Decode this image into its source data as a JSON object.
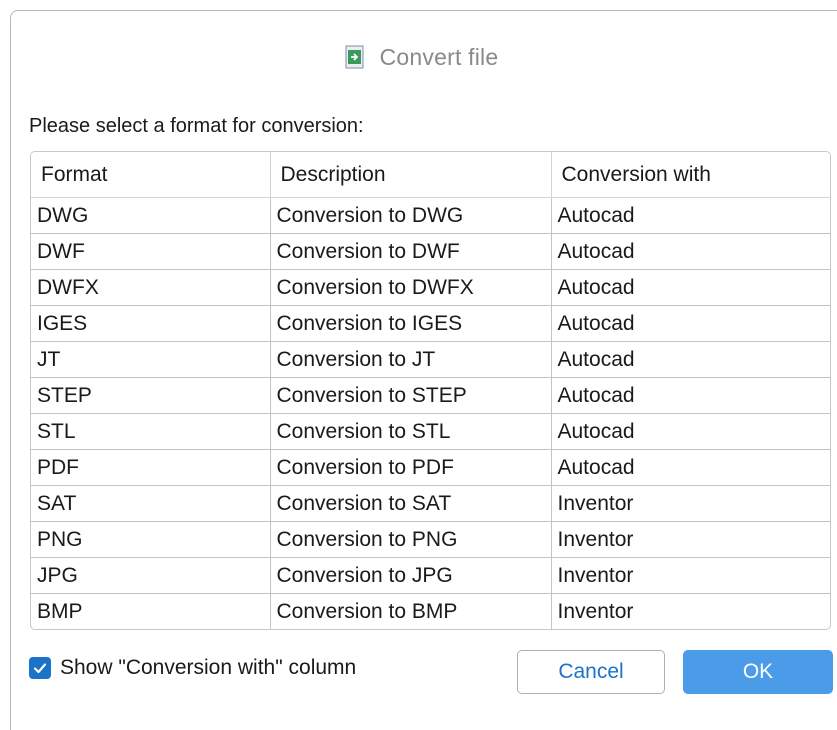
{
  "dialog": {
    "title": "Convert file",
    "title_icon": "convert-file-icon",
    "prompt": "Please select a format for conversion:"
  },
  "table": {
    "columns": [
      "Format",
      "Description",
      "Conversion with"
    ],
    "rows": [
      [
        "DWG",
        "Conversion to DWG",
        "Autocad"
      ],
      [
        "DWF",
        "Conversion to DWF",
        "Autocad"
      ],
      [
        "DWFX",
        "Conversion to DWFX",
        "Autocad"
      ],
      [
        "IGES",
        "Conversion to IGES",
        "Autocad"
      ],
      [
        "JT",
        "Conversion to JT",
        "Autocad"
      ],
      [
        "STEP",
        "Conversion to STEP",
        "Autocad"
      ],
      [
        "STL",
        "Conversion to STL",
        "Autocad"
      ],
      [
        "PDF",
        "Conversion to PDF",
        "Autocad"
      ],
      [
        "SAT",
        "Conversion to SAT",
        "Inventor"
      ],
      [
        "PNG",
        "Conversion to PNG",
        "Inventor"
      ],
      [
        "JPG",
        "Conversion to JPG",
        "Inventor"
      ],
      [
        "BMP",
        "Conversion to BMP",
        "Inventor"
      ]
    ]
  },
  "footer": {
    "show_column_label": "Show \"Conversion with\" column",
    "show_column_checked": true,
    "cancel_label": "Cancel",
    "ok_label": "OK"
  },
  "colors": {
    "accent": "#1a73c7",
    "ok_button": "#4a9be8",
    "title_text": "#8a8a8a"
  }
}
